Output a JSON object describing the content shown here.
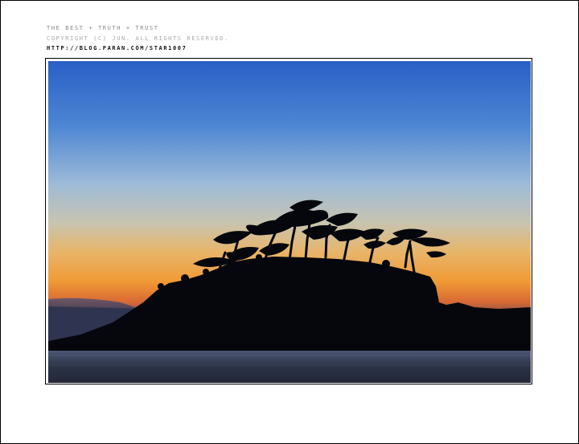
{
  "header": {
    "tagline": "THE BEST + TRUTH + TRUST",
    "copyright": "COPYRIGHT (C) JUN. ALL RIGHTS RESERVED.",
    "url": "HTTP://BLOG.PARAN.COM/STAR1007"
  },
  "photo": {
    "subject": "silhouette of a pine-covered islet at sunset over calm water",
    "colors": {
      "sky_top": "#2c63c9",
      "sky_mid": "#a9c1d4",
      "horizon": "#f0a23c",
      "land": "#05070d",
      "water": "#3e4a63"
    }
  }
}
